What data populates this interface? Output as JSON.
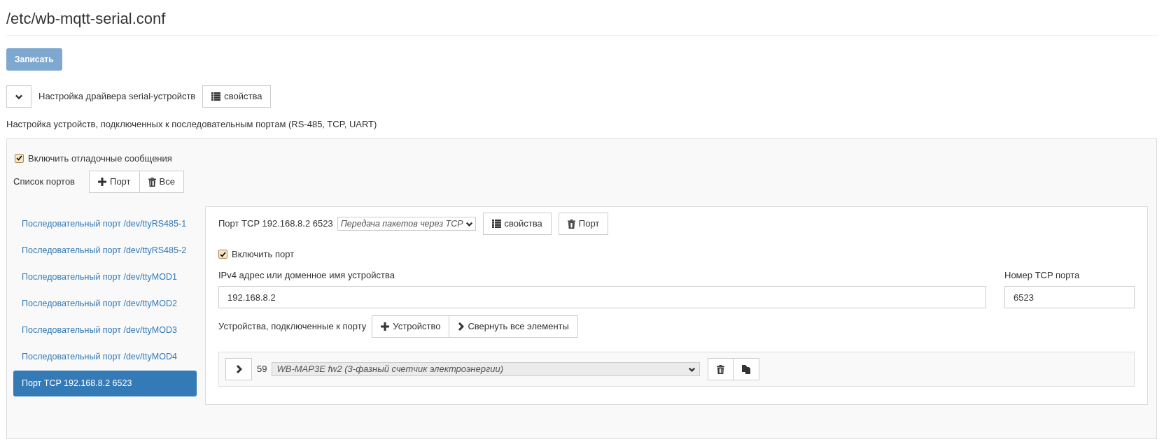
{
  "title": "/etc/wb-mqtt-serial.conf",
  "save_button": {
    "label": "Записать",
    "disabled": true
  },
  "driver": {
    "expanded": true,
    "label": "Настройка драйвера serial-устройств",
    "properties_button": "свойства"
  },
  "section_title": "Настройка устройств, подключенных к последовательным портам (RS-485, TCP, UART)",
  "debug": {
    "label": "Включить отладочные сообщения",
    "checked": true
  },
  "ports_header": {
    "label": "Список портов",
    "add_button": "Порт",
    "delete_all_button": "Все"
  },
  "ports": [
    {
      "label": "Последовательный порт /dev/ttyRS485-1",
      "selected": false
    },
    {
      "label": "Последовательный порт /dev/ttyRS485-2",
      "selected": false
    },
    {
      "label": "Последовательный порт /dev/ttyMOD1",
      "selected": false
    },
    {
      "label": "Последовательный порт /dev/ttyMOD2",
      "selected": false
    },
    {
      "label": "Последовательный порт /dev/ttyMOD3",
      "selected": false
    },
    {
      "label": "Последовательный порт /dev/ttyMOD4",
      "selected": false
    },
    {
      "label": "Порт TCP 192.168.8.2 6523",
      "selected": true
    }
  ],
  "port_panel": {
    "title": "Порт TCP 192.168.8.2 6523",
    "mode": "Передача пакетов через TCP",
    "properties_button": "свойства",
    "delete_button": "Порт",
    "enable": {
      "label": "Включить порт",
      "checked": true
    },
    "address": {
      "label": "IPv4 адрес или доменное имя устройства",
      "value": "192.168.8.2"
    },
    "tcp_port": {
      "label": "Номер TCP порта",
      "value": "6523"
    },
    "devices_label": "Устройства, подключенные к порту",
    "add_device_button": "Устройство",
    "collapse_button": "Свернуть все элементы",
    "devices": [
      {
        "expanded": false,
        "address": "59",
        "type": "WB-MAP3E fw2 (3-фазный счетчик электроэнергии)"
      }
    ]
  }
}
